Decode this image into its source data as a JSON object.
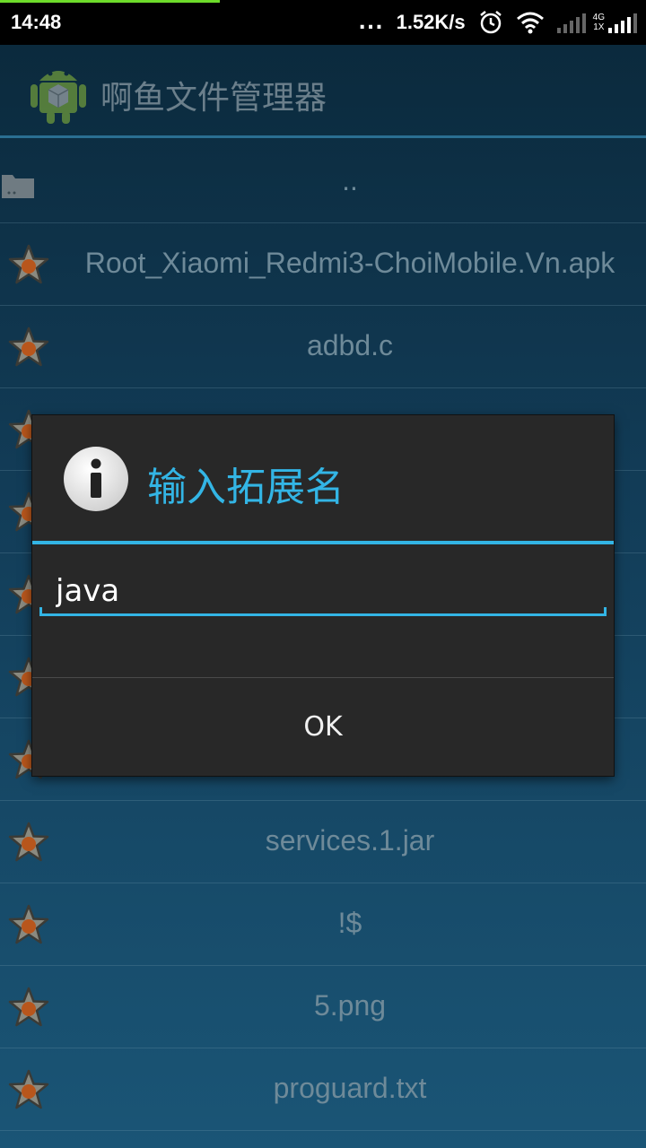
{
  "status_bar": {
    "time": "14:48",
    "more": "...",
    "net_speed": "1.52K/s",
    "net_type_top": "4G",
    "net_type_bottom": "1X",
    "load_progress": 0.34
  },
  "app": {
    "title": "啊鱼文件管理器",
    "icon": "android-icon"
  },
  "files": [
    {
      "name": "..",
      "icon": "folder-icon"
    },
    {
      "name": "Root_Xiaomi_Redmi3-ChoiMobile.Vn.apk",
      "icon": "star-icon"
    },
    {
      "name": "adbd.c",
      "icon": "star-icon"
    },
    {
      "name": "",
      "icon": "star-icon"
    },
    {
      "name": "",
      "icon": "star-icon"
    },
    {
      "name": "",
      "icon": "star-icon"
    },
    {
      "name": "",
      "icon": "star-icon"
    },
    {
      "name": "",
      "icon": "star-icon"
    },
    {
      "name": "services.1.jar",
      "icon": "star-icon"
    },
    {
      "name": "!$",
      "icon": "star-icon"
    },
    {
      "name": "5.png",
      "icon": "star-icon"
    },
    {
      "name": "proguard.txt",
      "icon": "star-icon"
    }
  ],
  "dialog": {
    "title": "输入拓展名",
    "icon": "info-icon",
    "input_value": "java",
    "ok_label": "OK",
    "accent_color": "#33b5e5"
  }
}
